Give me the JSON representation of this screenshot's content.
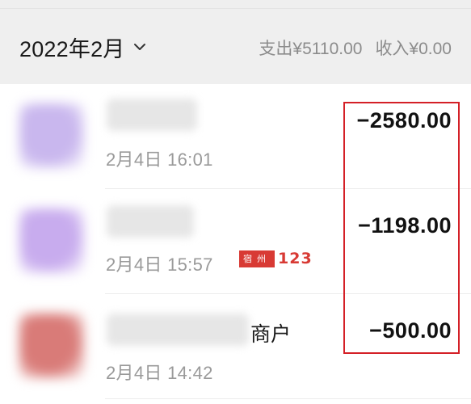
{
  "header": {
    "month": "2022年2月",
    "expense": "支出¥5110.00",
    "income": "收入¥0.00"
  },
  "transactions": [
    {
      "time": "2月4日 16:01",
      "amount": "−2580.00",
      "avatar_color": "#c9b7ee",
      "merchant_suffix": ""
    },
    {
      "time": "2月4日 15:57",
      "amount": "−1198.00",
      "avatar_color": "#c8acee",
      "merchant_suffix": ""
    },
    {
      "time": "2月4日 14:42",
      "amount": "−500.00",
      "avatar_color": "#d97b78",
      "merchant_suffix": "商户"
    }
  ],
  "watermark": {
    "seal_text": "宿州",
    "number": "123"
  },
  "colors": {
    "highlight": "#d42027",
    "header_bg": "#efefef",
    "amount_text": "#111111",
    "secondary_text": "#9a9a9a"
  }
}
